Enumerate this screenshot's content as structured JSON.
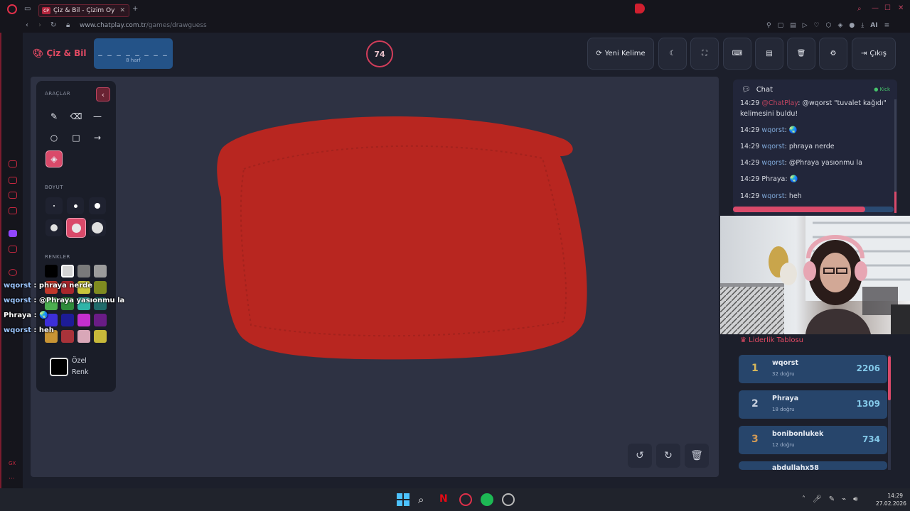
{
  "browser": {
    "tab_title": "Çiz & Bil - Çizim Oy",
    "url_domain": "www.chatplay.com.tr",
    "url_path": "/games/drawguess",
    "ai_label": "AI"
  },
  "header": {
    "logo": "Çiz & Bil",
    "word_mask": "_ _ _ _ _ _ _ _",
    "word_length": "8 harf",
    "timer": "74",
    "new_word": "Yeni Kelime",
    "exit": "Çıkış"
  },
  "tools": {
    "tools_label": "ARAÇLAR",
    "size_label": "BOYUT",
    "colors_label": "RENKLER",
    "custom_color_line1": "Özel",
    "custom_color_line2": "Renk",
    "colors": [
      "#000000",
      "#d4d4d4",
      "#7a7a7a",
      "#9c9c9c",
      "#c0382b",
      "#a8262c",
      "#c8c43a",
      "#7f8b20",
      "#4caf50",
      "#2e8b3a",
      "#2fb4a8",
      "#206b6b",
      "#3d2fd9",
      "#1d1c96",
      "#c42fcf",
      "#6a1c86",
      "#c89434",
      "#a8333a",
      "#d9a7b8",
      "#c8b93a"
    ]
  },
  "chat": {
    "title": "Chat",
    "platform": "Kick",
    "messages": [
      {
        "time": "14:29",
        "user": "@ChatPlay",
        "text": ": @wqorst \"tuvalet kağıdı\" kelimesini buldu!"
      },
      {
        "time": "14:29",
        "user": "wqorst",
        "text": ": 🌏"
      },
      {
        "time": "14:29",
        "user": "wqorst",
        "text": ": phraya nerde"
      },
      {
        "time": "14:29",
        "user": "wqorst",
        "text": ": @Phraya yasıonmu la"
      },
      {
        "time": "14:29",
        "user": "Phraya",
        "text": ": 🌏"
      },
      {
        "time": "14:29",
        "user": "wqorst",
        "text": ": heh"
      }
    ]
  },
  "leaderboard": {
    "title": "Liderlik Tablosu",
    "rows": [
      {
        "rank": "1",
        "name": "wqorst",
        "sub": "32 doğru",
        "score": "2206"
      },
      {
        "rank": "2",
        "name": "Phraya",
        "sub": "18 doğru",
        "score": "1309"
      },
      {
        "rank": "3",
        "name": "bonibonlukek",
        "sub": "12 doğru",
        "score": "734"
      },
      {
        "rank": "",
        "name": "abdullahx58",
        "sub": "",
        "score": ""
      }
    ]
  },
  "overlay_chat": [
    {
      "user": "wqorst",
      "text": " : phraya nerde"
    },
    {
      "user": "wqorst",
      "text": " : @Phraya yasıonmu la"
    },
    {
      "user": "Phraya",
      "text": " : 🌏"
    },
    {
      "user": "wqorst",
      "text": " : heh"
    }
  ],
  "taskbar": {
    "time": "14:29",
    "date": "27.02.2026"
  },
  "accent": "#e24a63",
  "paint_color": "#b82620"
}
